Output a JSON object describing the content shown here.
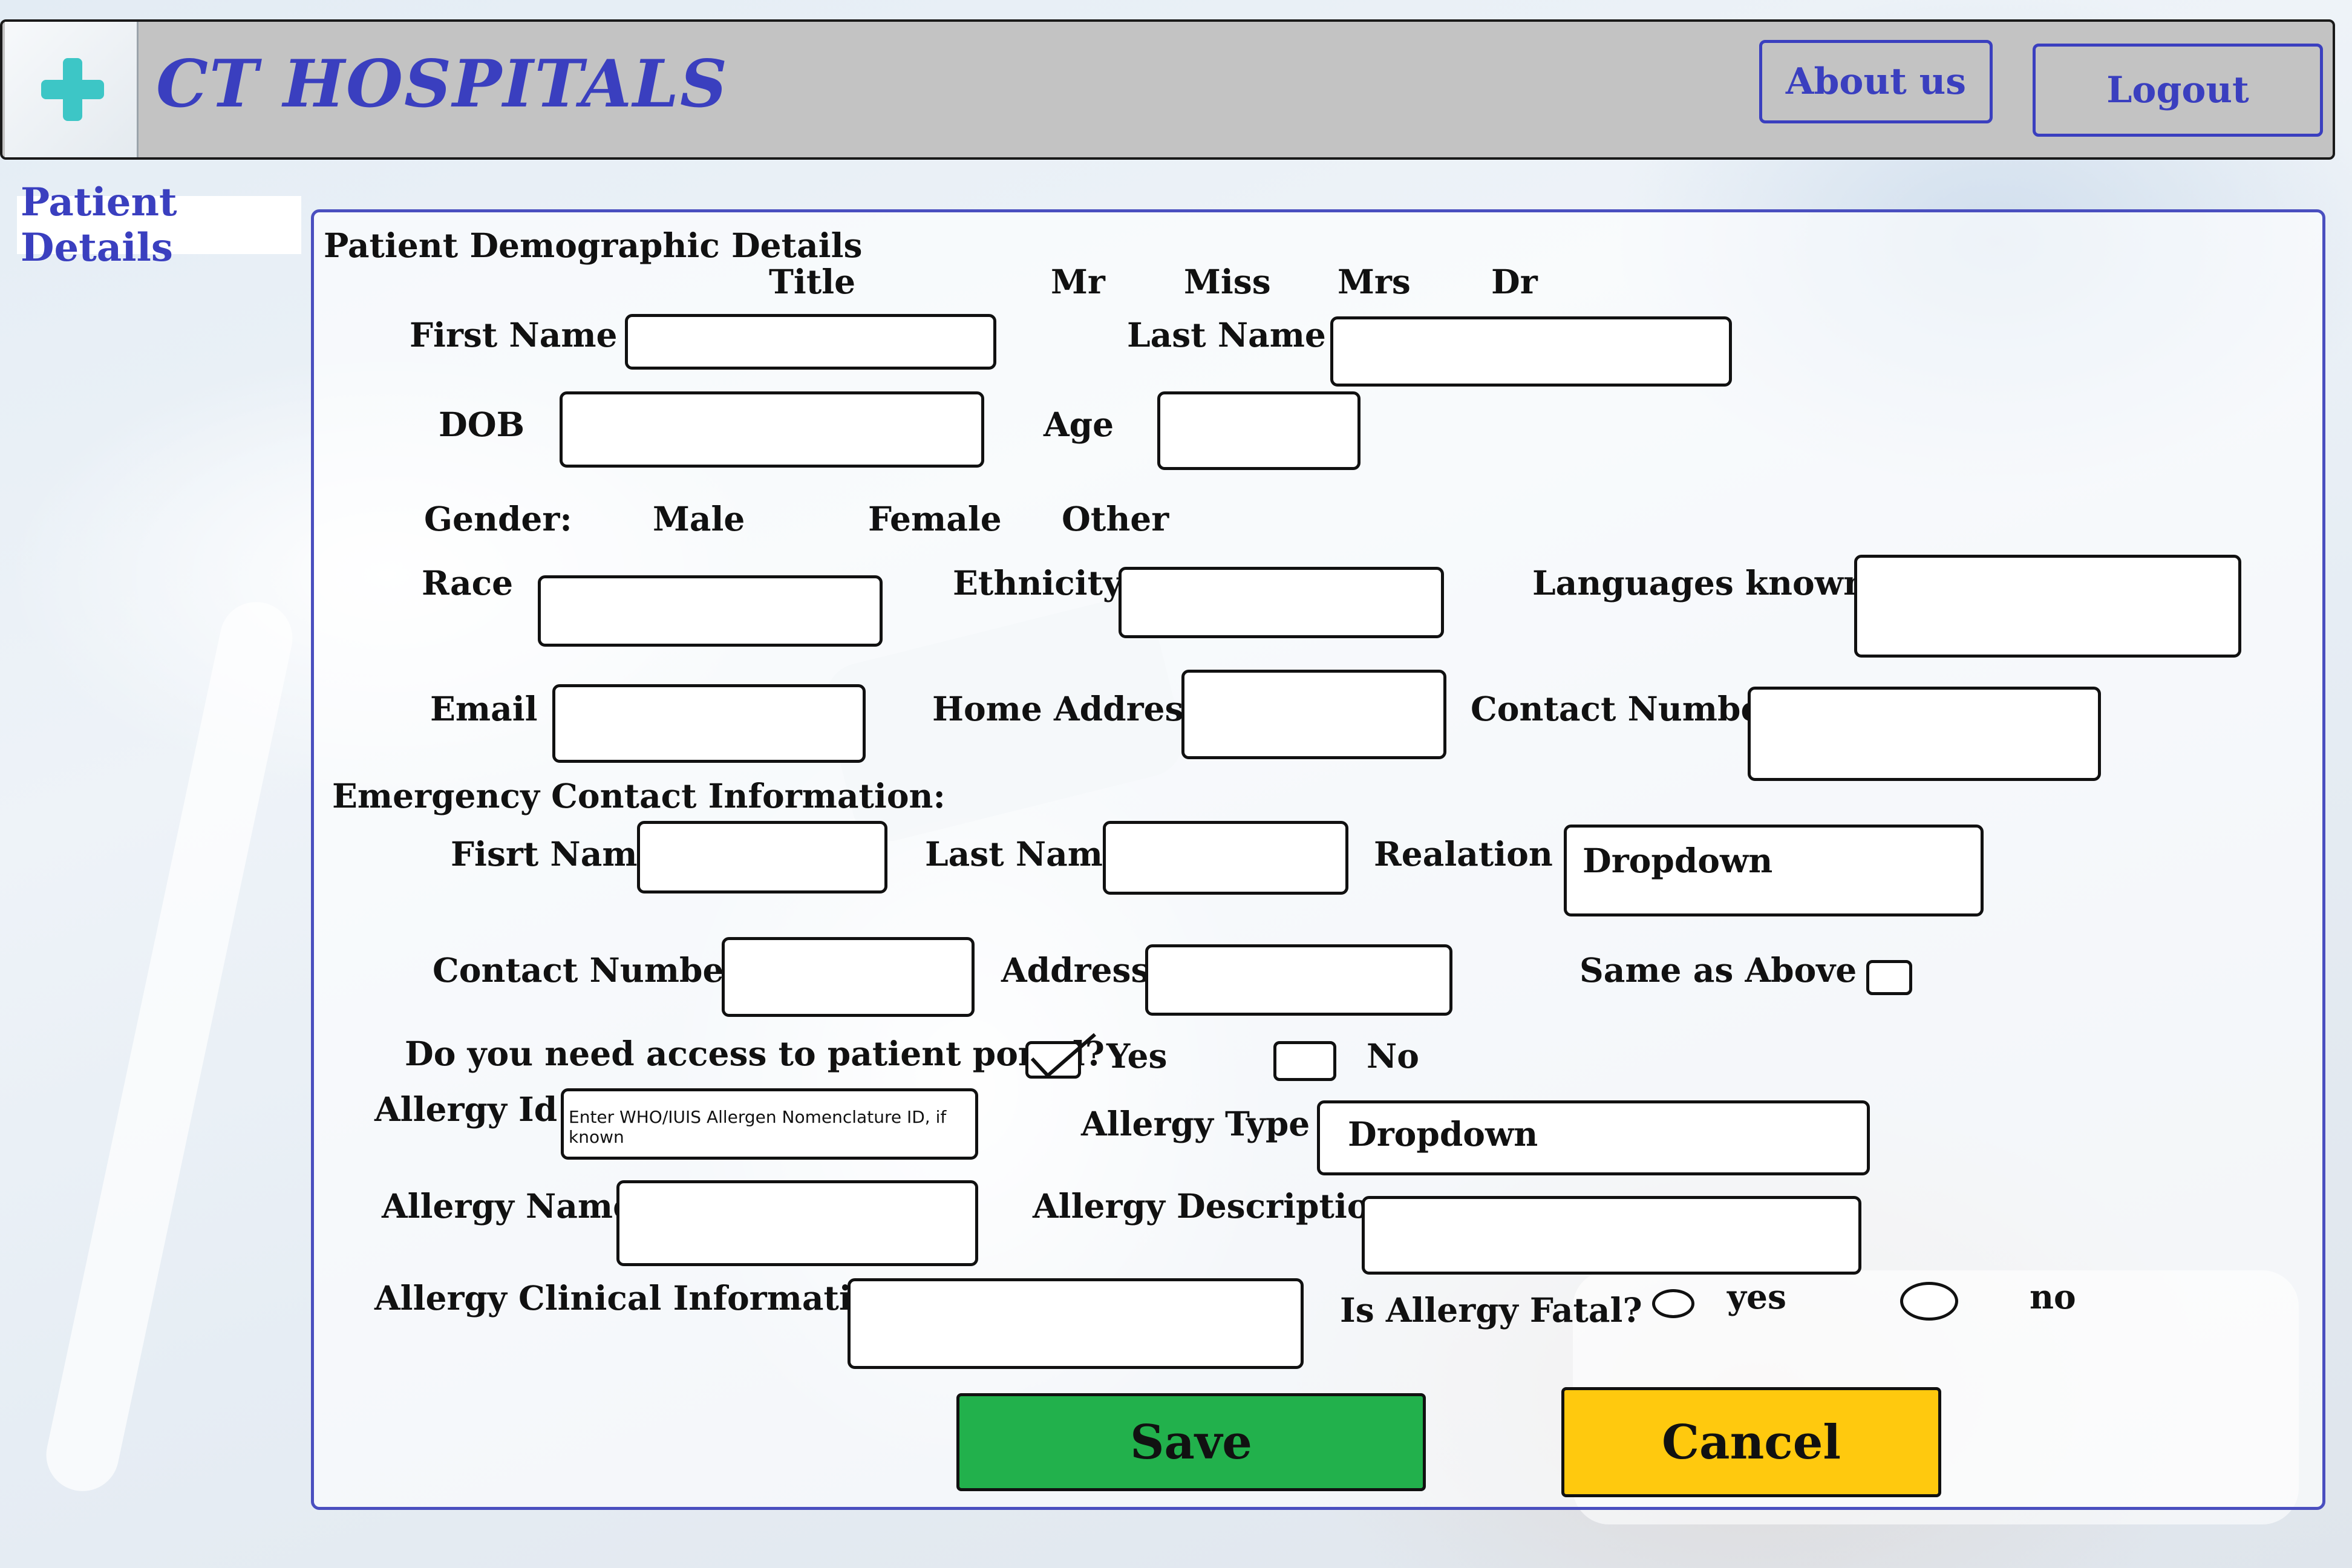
{
  "header": {
    "brand": "CT HOSPITALS",
    "about_label": "About us",
    "logout_label": "Logout"
  },
  "sidebar": {
    "tab_label": "Patient Details"
  },
  "demographics": {
    "section_title": "Patient Demographic Details",
    "title_label": "Title",
    "title_options": [
      "Mr",
      "Miss",
      "Mrs",
      "Dr"
    ],
    "first_name_label": "First Name",
    "last_name_label": "Last Name",
    "dob_label": "DOB",
    "age_label": "Age",
    "gender_label": "Gender:",
    "gender_options": [
      "Male",
      "Female",
      "Other"
    ],
    "race_label": "Race",
    "ethnicity_label": "Ethnicity",
    "languages_label": "Languages known",
    "email_label": "Email",
    "home_address_label": "Home Addresss",
    "contact_number_label": "Contact Number"
  },
  "emergency": {
    "section_title": "Emergency Contact Information:",
    "first_name_label": "Fisrt Name",
    "last_name_label": "Last Name",
    "relation_label": "Realation",
    "relation_value": "Dropdown",
    "contact_number_label": "Contact Number",
    "address_label": "Address",
    "same_as_above_label": "Same as Above"
  },
  "portal": {
    "question": "Do you need access to patient portal?",
    "yes_label": "Yes",
    "no_label": "No",
    "yes_checked": true
  },
  "allergy": {
    "id_label": "Allergy Id",
    "id_placeholder": "Enter WHO/IUIS Allergen Nomenclature ID, if known",
    "type_label": "Allergy Type",
    "type_value": "Dropdown",
    "name_label": "Allergy Name",
    "description_label": "Allergy Description",
    "clinical_label": "Allergy Clinical Information",
    "fatal_label": "Is Allergy Fatal?",
    "fatal_yes": "yes",
    "fatal_no": "no"
  },
  "actions": {
    "save_label": "Save",
    "cancel_label": "Cancel"
  },
  "colors": {
    "brand": "#3a3fbf",
    "header_bg": "#c3c3c3",
    "save_bg": "#22b14c",
    "cancel_bg": "#ffc90e"
  }
}
